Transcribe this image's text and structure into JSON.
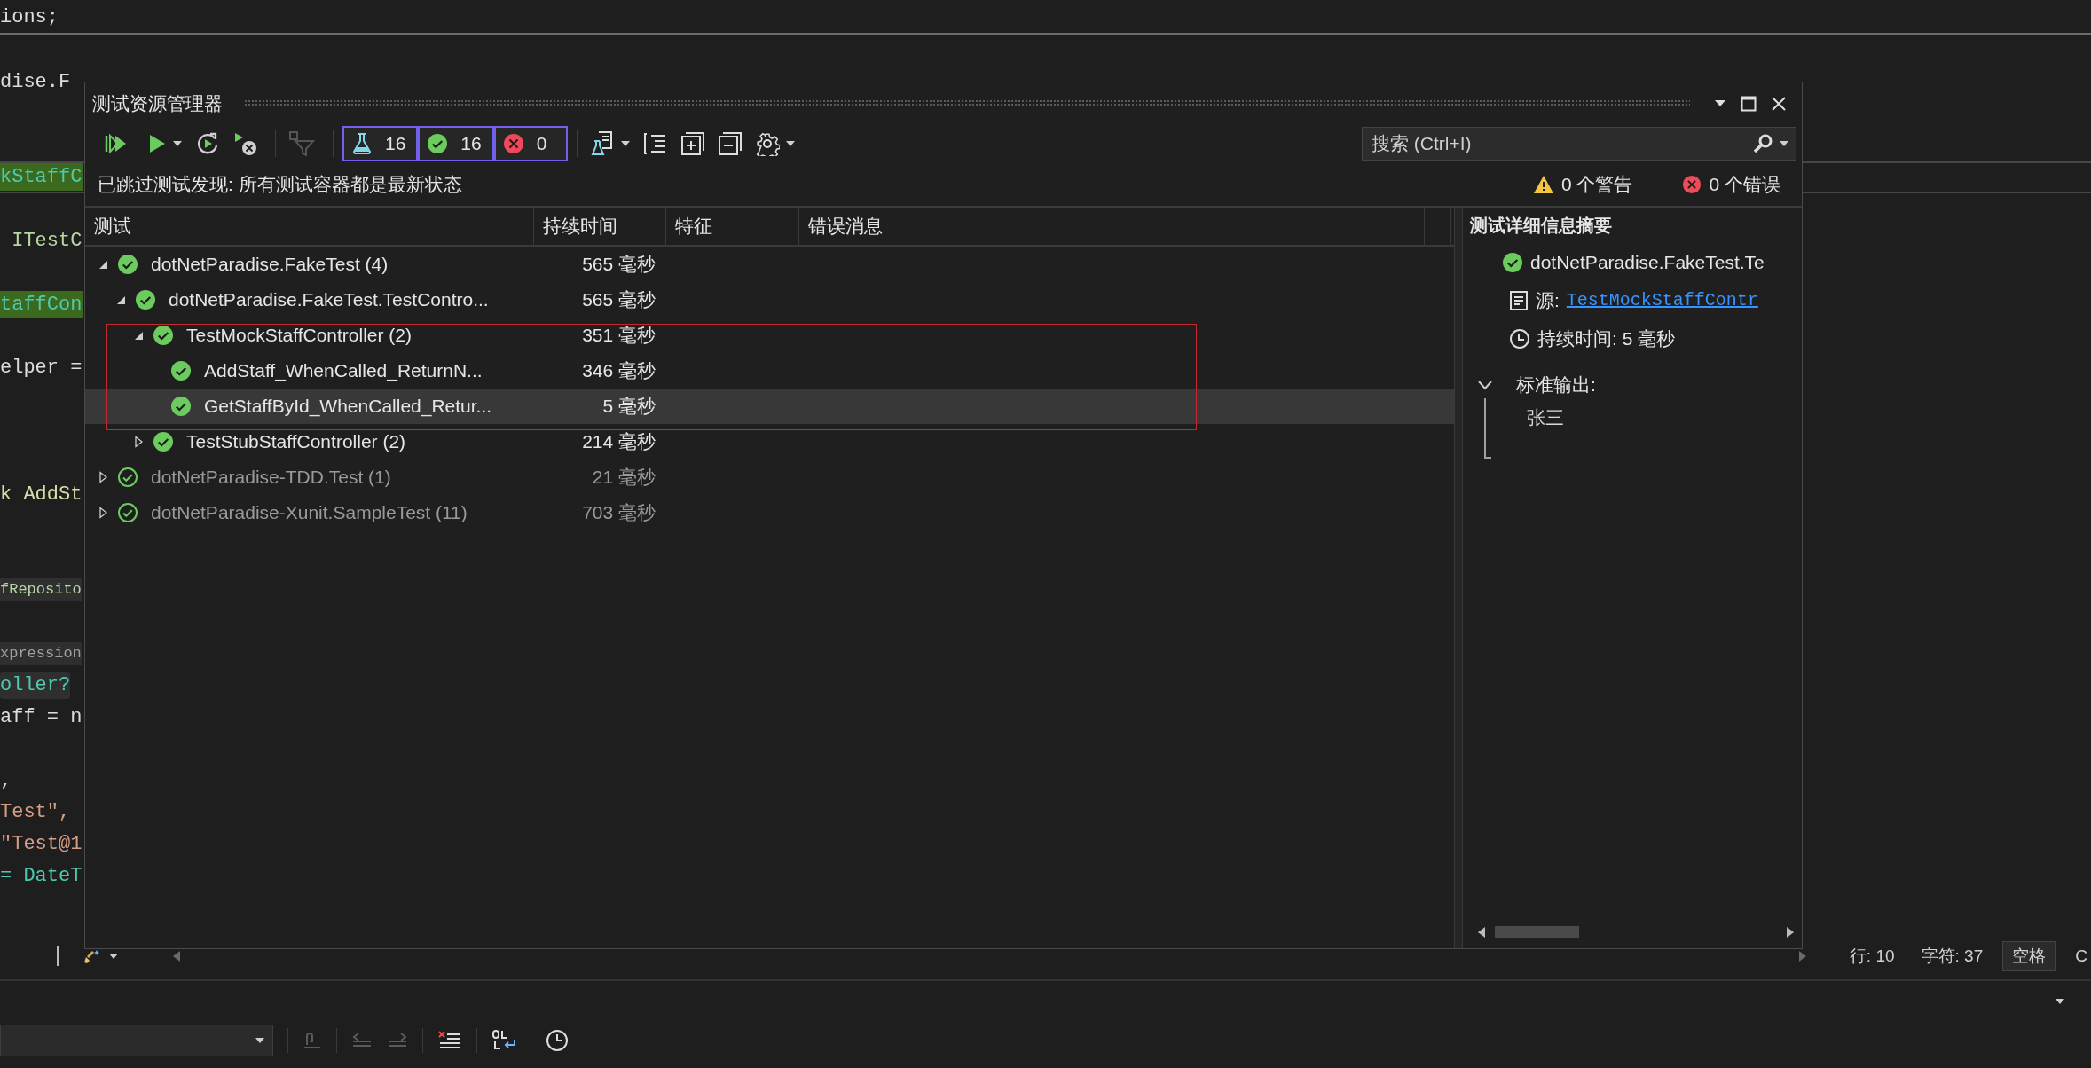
{
  "editor": {
    "lines": [
      {
        "text": "ions;",
        "kind": "sticky"
      },
      {
        "kind": "blank"
      },
      {
        "text": "dise.F",
        "kind": "plain"
      },
      {
        "kind": "blank"
      },
      {
        "kind": "blank"
      },
      {
        "text": "kStaffC",
        "kind": "highlight",
        "current": true
      },
      {
        "kind": "blank"
      },
      {
        "text": " ITestC",
        "kind": "interface"
      },
      {
        "kind": "blank"
      },
      {
        "text": "taffCon",
        "kind": "highlight"
      },
      {
        "kind": "blank"
      },
      {
        "text": "elper =",
        "kind": "plain"
      },
      {
        "kind": "blank"
      },
      {
        "kind": "blank"
      },
      {
        "kind": "blank"
      },
      {
        "text": "k AddSt",
        "kind": "method"
      },
      {
        "kind": "blank"
      },
      {
        "kind": "blank"
      },
      {
        "text": "fReposito",
        "kind": "badge"
      },
      {
        "kind": "blank"
      },
      {
        "text": "xpression",
        "kind": "badge-muted"
      },
      {
        "text": "oller?",
        "kind": "badge-type"
      },
      {
        "text": "aff = n",
        "kind": "plain"
      },
      {
        "kind": "blank"
      },
      {
        "text": ",",
        "kind": "plain"
      },
      {
        "text": "Test\",",
        "kind": "string"
      },
      {
        "text": "\"Test@1",
        "kind": "string"
      },
      {
        "text": "= DateT",
        "kind": "type"
      }
    ]
  },
  "editor_status": {
    "line": "行: 10",
    "column": "字符: 37",
    "indent": "空格",
    "line_ending": "C"
  },
  "explorer": {
    "title": "测试资源管理器",
    "counts": [
      {
        "kind": "total",
        "count": "16",
        "selected": true
      },
      {
        "kind": "passed",
        "count": "16",
        "selected": true
      },
      {
        "kind": "failed",
        "count": "0",
        "selected": true
      }
    ],
    "search": {
      "placeholder": "搜索 (Ctrl+I)"
    },
    "status_message": "已跳过测试发现: 所有测试容器都是最新状态",
    "warnings": "0 个警告",
    "errors": "0 个错误",
    "columns": [
      "测试",
      "持续时间",
      "特征",
      "错误消息"
    ],
    "tree": [
      {
        "name": "dotNetParadise.FakeTest (4)",
        "duration": "565 毫秒",
        "expanded": true,
        "selected": false,
        "dimmed": false,
        "children": [
          {
            "name": "dotNetParadise.FakeTest.TestContro...",
            "duration": "565 毫秒",
            "expanded": true,
            "selected": false,
            "dimmed": false,
            "children": [
              {
                "name": "TestMockStaffController (2)",
                "duration": "351 毫秒",
                "expanded": true,
                "selected": false,
                "dimmed": false,
                "children": [
                  {
                    "name": "AddStaff_WhenCalled_ReturnN...",
                    "duration": "346 毫秒",
                    "selected": false,
                    "dimmed": false
                  },
                  {
                    "name": "GetStaffById_WhenCalled_Retur...",
                    "duration": "5 毫秒",
                    "selected": true,
                    "dimmed": false
                  }
                ]
              },
              {
                "name": "TestStubStaffController (2)",
                "duration": "214 毫秒",
                "expanded": false,
                "selected": false,
                "dimmed": false
              }
            ]
          }
        ]
      },
      {
        "name": "dotNetParadise-TDD.Test (1)",
        "duration": "21 毫秒",
        "expanded": false,
        "selected": false,
        "dimmed": true
      },
      {
        "name": "dotNetParadise-Xunit.SampleTest (11)",
        "duration": "703 毫秒",
        "expanded": false,
        "selected": false,
        "dimmed": true
      }
    ],
    "details": {
      "title": "测试详细信息摘要",
      "test_name": "dotNetParadise.FakeTest.Te",
      "source_label": "源:",
      "source_link": "TestMockStaffContr",
      "duration": "持续时间: 5 毫秒",
      "output_label": "标准输出:",
      "output_expanded": true,
      "output": "张三"
    }
  }
}
